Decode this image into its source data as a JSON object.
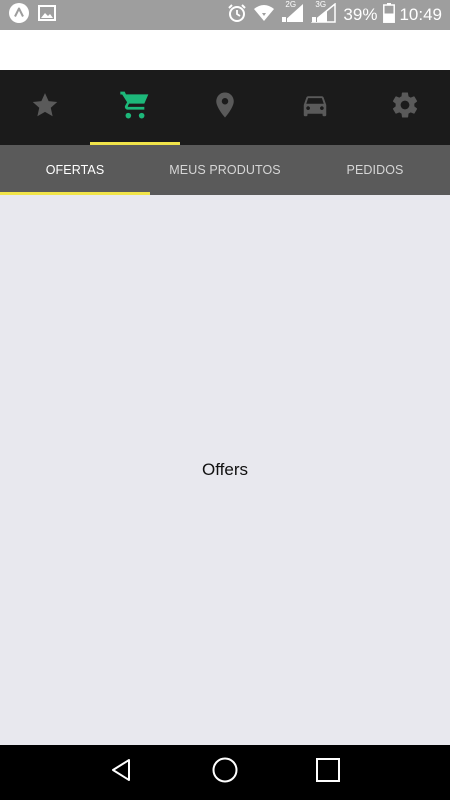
{
  "status_bar": {
    "left_icons": [
      "app-logo-icon",
      "image-notification-icon"
    ],
    "right_icons": [
      "alarm-icon",
      "wifi-icon",
      "signal-sim1-icon",
      "signal-sim2-icon",
      "battery-icon"
    ],
    "sim1_label": "2G",
    "sim2_label": "3G",
    "battery_text": "39%",
    "time": "10:49"
  },
  "icon_tabs": [
    {
      "icon": "star-icon",
      "active": false,
      "color": "#5a5a5a"
    },
    {
      "icon": "cart-icon",
      "active": true,
      "color": "#1db87a"
    },
    {
      "icon": "location-pin-icon",
      "active": false,
      "color": "#5a5a5a"
    },
    {
      "icon": "car-icon",
      "active": false,
      "color": "#5a5a5a"
    },
    {
      "icon": "gear-icon",
      "active": false,
      "color": "#5a5a5a"
    }
  ],
  "text_tabs": [
    {
      "label": "OFERTAS",
      "active": true
    },
    {
      "label": "MEUS PRODUTOS",
      "active": false
    },
    {
      "label": "PEDIDOS",
      "active": false
    }
  ],
  "content": {
    "text": "Offers"
  },
  "nav_bar": {
    "buttons": [
      "back-icon",
      "home-icon",
      "recents-icon"
    ]
  },
  "colors": {
    "status_bar_bg": "#9e9e9e",
    "icon_tab_bg": "#1b1b1b",
    "text_tab_bg": "#5a5a5a",
    "indicator": "#f1e44a",
    "active_icon": "#1db87a",
    "content_bg": "#e8e8ee"
  }
}
